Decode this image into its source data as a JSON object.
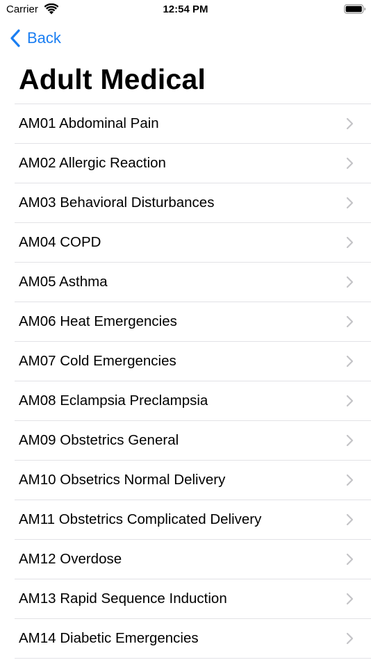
{
  "status_bar": {
    "carrier": "Carrier",
    "time": "12:54 PM",
    "icons": [
      "wifi-icon",
      "battery-icon"
    ]
  },
  "nav": {
    "back_label": "Back",
    "back_icon": "chevron-left-icon",
    "accent_color": "#1a7ef2"
  },
  "page": {
    "title": "Adult Medical"
  },
  "list": {
    "items": [
      {
        "label": "AM01 Abdominal Pain"
      },
      {
        "label": "AM02 Allergic Reaction"
      },
      {
        "label": "AM03 Behavioral Disturbances"
      },
      {
        "label": "AM04 COPD"
      },
      {
        "label": "AM05 Asthma"
      },
      {
        "label": "AM06 Heat Emergencies"
      },
      {
        "label": "AM07 Cold Emergencies"
      },
      {
        "label": "AM08 Eclampsia Preclampsia"
      },
      {
        "label": "AM09 Obstetrics General"
      },
      {
        "label": "AM10 Obsetrics Normal Delivery"
      },
      {
        "label": "AM11 Obstetrics Complicated Delivery"
      },
      {
        "label": "AM12 Overdose"
      },
      {
        "label": "AM13 Rapid Sequence Induction"
      },
      {
        "label": "AM14 Diabetic Emergencies"
      }
    ],
    "disclosure_icon": "chevron-right-icon"
  }
}
